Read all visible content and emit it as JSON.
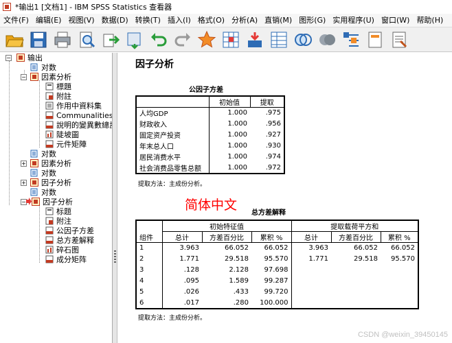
{
  "window": {
    "title": "*输出1 [文档1] - IBM SPSS Statistics 查看器"
  },
  "menu": [
    "文件(F)",
    "编辑(E)",
    "视图(V)",
    "数据(D)",
    "转换(T)",
    "插入(I)",
    "格式(O)",
    "分析(A)",
    "直销(M)",
    "图形(G)",
    "实用程序(U)",
    "窗口(W)",
    "帮助(H)"
  ],
  "toolbar_icons": [
    "open-icon",
    "save-icon",
    "print-icon",
    "print-preview-icon",
    "export-icon",
    "recall-dialog-icon",
    "undo-icon",
    "redo-icon",
    "goto-data-icon",
    "goto-case-icon",
    "goto-variable-icon",
    "variables-icon",
    "designate-window-icon",
    "show-all-icon",
    "insert-heading-icon",
    "insert-title-icon",
    "insert-text-icon"
  ],
  "tree": {
    "root": "输出",
    "log1": "对数",
    "factor1": "因素分析",
    "factor1_children": [
      "標題",
      "附註",
      "作用中資料集",
      "Communalities",
      "說明的變異數總計",
      "陡坡圖",
      "元件矩陣"
    ],
    "log2": "对数",
    "factor2": "因素分析",
    "log3": "对数",
    "factor3": "因子分析",
    "log4": "对数",
    "factor4": "因子分析",
    "factor4_children": [
      "标题",
      "附注",
      "公因子方差",
      "总方差解释",
      "碎石图",
      "成分矩阵"
    ]
  },
  "viewer": {
    "heading": "因子分析",
    "communalities": {
      "title": "公因子方差",
      "headers": [
        "初始值",
        "提取"
      ],
      "rows": [
        {
          "label": "人均GDP",
          "initial": "1.000",
          "extraction": ".975"
        },
        {
          "label": "财政收入",
          "initial": "1.000",
          "extraction": ".956"
        },
        {
          "label": "固定资产投资",
          "initial": "1.000",
          "extraction": ".927"
        },
        {
          "label": "年末总人口",
          "initial": "1.000",
          "extraction": ".930"
        },
        {
          "label": "居民消费水平",
          "initial": "1.000",
          "extraction": ".974"
        },
        {
          "label": "社会消费品零售总额",
          "initial": "1.000",
          "extraction": ".972"
        }
      ],
      "footnote": "提取方法：主成份分析。"
    },
    "annotation": "简体中文",
    "variance": {
      "title": "总方差解释",
      "group_label": "组件",
      "initial_label": "初始特征值",
      "extraction_label": "提取载荷平方和",
      "sub_headers": [
        "总计",
        "方差百分比",
        "累积 %",
        "总计",
        "方差百分比",
        "累积 %"
      ],
      "rows": [
        [
          "1",
          "3.963",
          "66.052",
          "66.052",
          "3.963",
          "66.052",
          "66.052"
        ],
        [
          "2",
          "1.771",
          "29.518",
          "95.570",
          "1.771",
          "29.518",
          "95.570"
        ],
        [
          "3",
          ".128",
          "2.128",
          "97.698",
          "",
          "",
          ""
        ],
        [
          "4",
          ".095",
          "1.589",
          "99.287",
          "",
          "",
          ""
        ],
        [
          "5",
          ".026",
          ".433",
          "99.720",
          "",
          "",
          ""
        ],
        [
          "6",
          ".017",
          ".280",
          "100.000",
          "",
          "",
          ""
        ]
      ],
      "footnote": "提取方法：主成份分析。"
    },
    "watermark": "CSDN @weixin_39450145"
  }
}
